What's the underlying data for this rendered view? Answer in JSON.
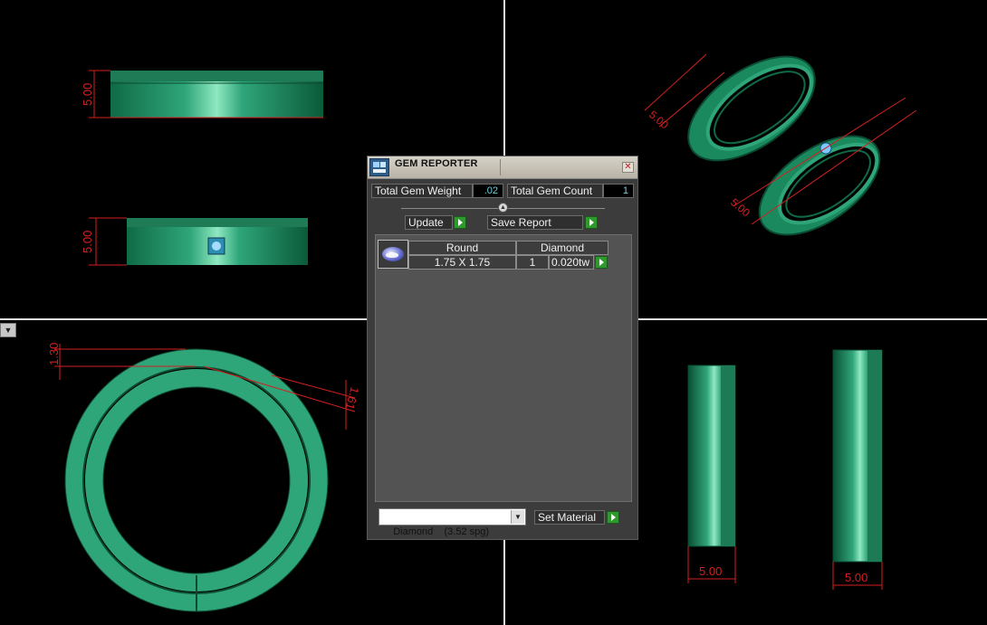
{
  "dimension_labels": {
    "front_top": "5.00",
    "front_bottom": "5.00",
    "perspective_left": "5.00",
    "perspective_right": "5.00",
    "top_view_a": "1.30",
    "top_view_b": "1.61",
    "side_left": "5.00",
    "side_right": "5.00"
  },
  "panel": {
    "title": "GEM REPORTER",
    "close_glyph": "✕",
    "total_gem_weight_label": "Total Gem Weight",
    "total_gem_weight_value": ".02",
    "total_gem_count_label": "Total Gem Count",
    "total_gem_count_value": "1",
    "update_label": "Update",
    "save_report_label": "Save Report",
    "table": {
      "headers": [
        "Round",
        "Diamond"
      ],
      "row": {
        "size": "1.75 X 1.75",
        "count": "1",
        "weight": "0.020tw"
      }
    },
    "material_select": "Diamond    (3.52 spg)",
    "set_material_label": "Set Material"
  },
  "colors": {
    "ring_green": "#2fa57a",
    "dimension_red": "#d42020",
    "panel_bg": "#3c3c3c",
    "go_green": "#2e9a2e"
  }
}
